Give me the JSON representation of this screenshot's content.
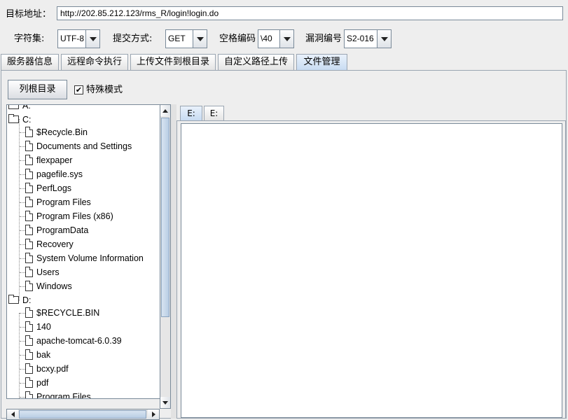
{
  "top": {
    "target_label": "目标地址：",
    "target_url": "http://202.85.212.123/rms_R/login!login.do",
    "charset_label": "字符集:",
    "charset_value": "UTF-8",
    "method_label": "提交方式:",
    "method_value": "GET",
    "space_label": "空格编码",
    "space_value": "\\40",
    "vuln_label": "漏洞编号",
    "vuln_value": "S2-016"
  },
  "tabs": [
    {
      "label": "服务器信息"
    },
    {
      "label": "远程命令执行"
    },
    {
      "label": "上传文件到根目录"
    },
    {
      "label": "自定义路径上传"
    },
    {
      "label": "文件管理",
      "active": true
    }
  ],
  "file_manager": {
    "list_root_button": "列根目录",
    "special_mode_label": "特殊模式",
    "special_mode_checked": true,
    "checkbox_glyph": "✔"
  },
  "tree": {
    "partial_top": "A:",
    "drive_c": "C:",
    "c_items": [
      "$Recycle.Bin",
      "Documents and Settings",
      "flexpaper",
      "pagefile.sys",
      "PerfLogs",
      "Program Files",
      "Program Files (x86)",
      "ProgramData",
      "Recovery",
      "System Volume Information",
      "Users",
      "Windows"
    ],
    "drive_d": "D:",
    "d_items": [
      "$RECYCLE.BIN",
      "140",
      "apache-tomcat-6.0.39",
      "bak",
      "bcxy.pdf",
      "pdf",
      "Program Files"
    ]
  },
  "file_tabs": [
    {
      "label": "E:",
      "active": true
    },
    {
      "label": "E:",
      "active": false
    }
  ]
}
